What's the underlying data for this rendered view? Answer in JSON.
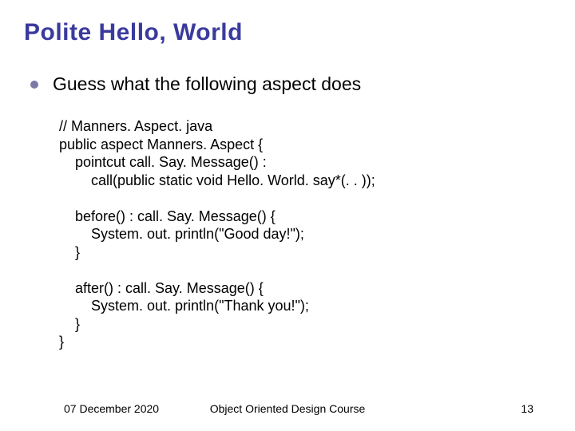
{
  "title": "Polite Hello, World",
  "bullet": "Guess what the following aspect does",
  "code": "// Manners. Aspect. java\npublic aspect Manners. Aspect {\n    pointcut call. Say. Message() :\n        call(public static void Hello. World. say*(. . ));\n\n    before() : call. Say. Message() {\n        System. out. println(\"Good day!\");\n    }\n\n    after() : call. Say. Message() {\n        System. out. println(\"Thank you!\");\n    }\n}",
  "footer": {
    "date": "07 December 2020",
    "course": "Object Oriented Design Course",
    "page": "13"
  }
}
